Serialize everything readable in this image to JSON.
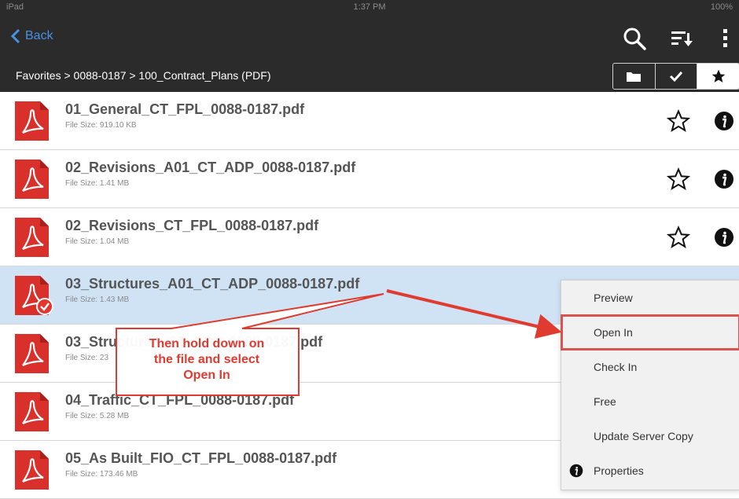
{
  "status_bar": {
    "carrier": "iPad",
    "time": "1:37 PM",
    "battery": "100%"
  },
  "nav": {
    "back_label": "Back"
  },
  "breadcrumb": "Favorites > 0088-0187 > 100_Contract_Plans (PDF)",
  "files": [
    {
      "name": "01_General_CT_FPL_0088-0187.pdf",
      "size": "File Size: 919.10 KB"
    },
    {
      "name": "02_Revisions_A01_CT_ADP_0088-0187.pdf",
      "size": "File Size: 1.41 MB"
    },
    {
      "name": "02_Revisions_CT_FPL_0088-0187.pdf",
      "size": "File Size: 1.04 MB"
    },
    {
      "name": "03_Structures_A01_CT_ADP_0088-0187.pdf",
      "size": "File Size: 1.43 MB"
    },
    {
      "name": "03_Structures_CT_FPL_0088-0187.pdf",
      "size": "File Size: 23"
    },
    {
      "name": "04_Traffic_CT_FPL_0088-0187.pdf",
      "size": "File Size: 5.28 MB"
    },
    {
      "name": "05_As Built_FIO_CT_FPL_0088-0187.pdf",
      "size": "File Size: 173.46 MB"
    }
  ],
  "context_menu": {
    "items": [
      "Preview",
      "Open In",
      "Check In",
      "Free",
      "Update Server Copy",
      "Properties"
    ],
    "highlighted": "Open In"
  },
  "annotation": {
    "line1": "Then hold down on",
    "line2": "the file and select",
    "line3": "Open In"
  },
  "colors": {
    "bar": "#2b2b2b",
    "accent": "#4a90e2",
    "pdf_red": "#d9302c",
    "selected_row": "#cfe3f5",
    "annotation": "#e03b30"
  },
  "icons": [
    "search-icon",
    "sort-icon",
    "more-icon",
    "folder-icon",
    "check-icon",
    "star-icon",
    "info-icon",
    "pdf-icon"
  ]
}
